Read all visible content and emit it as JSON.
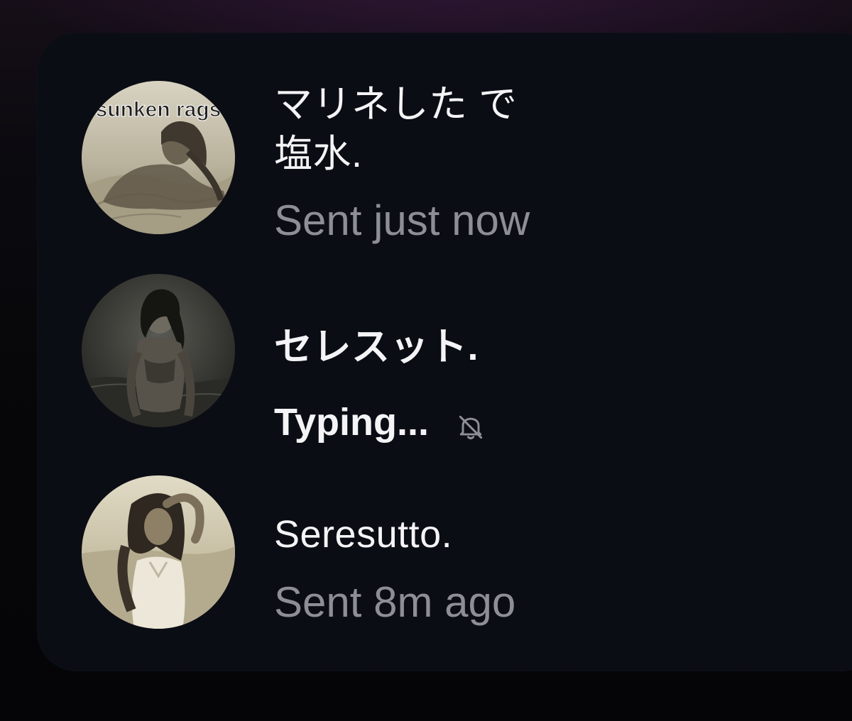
{
  "conversations": [
    {
      "name_lines": [
        "マリネした で",
        "塩水."
      ],
      "status": "Sent just now",
      "avatar_text": "sunken rags",
      "unread": false,
      "muted": false
    },
    {
      "name_lines": [
        "セレスット."
      ],
      "status": "Typing...",
      "unread": true,
      "muted": true,
      "mute_icon": "bell-slash-icon"
    },
    {
      "name_lines": [
        "Seresutto."
      ],
      "status": "Sent 8m ago",
      "unread": false,
      "muted": false
    }
  ],
  "colors": {
    "panel": "#0b0d14",
    "primary_text": "#f4f4f6",
    "secondary_text": "#8e8e95"
  }
}
